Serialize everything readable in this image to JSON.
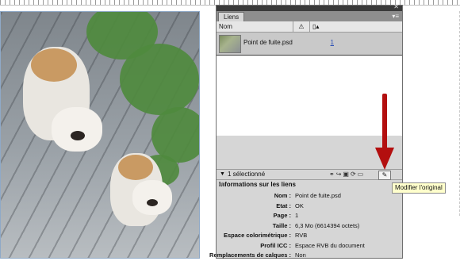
{
  "panel": {
    "tab_label": "Liens",
    "columns": {
      "name": "Nom",
      "warning_icon": "warning-icon",
      "page_icon": "page-icon"
    },
    "rows": [
      {
        "filename": "Point de fuite.psd",
        "page": "1"
      }
    ],
    "status": {
      "selected_text": "1 sélectionné"
    }
  },
  "info": {
    "header": "Informations sur les liens",
    "fields": [
      {
        "key": "Nom :",
        "value": "Point de fuite.psd"
      },
      {
        "key": "Etat :",
        "value": "OK"
      },
      {
        "key": "Page :",
        "value": "1"
      },
      {
        "key": "Taille :",
        "value": "6,3 Mo (6614394 octets)"
      },
      {
        "key": "Espace colorimétrique :",
        "value": "RVB"
      },
      {
        "key": "Profil ICC :",
        "value": "Espace RVB du document"
      },
      {
        "key": "Remplacements de calques :",
        "value": "Non"
      }
    ]
  },
  "tooltip": {
    "text": "Modifier l'original"
  },
  "colors": {
    "arrow": "#b30f0f",
    "tooltip_bg": "#ffffcc",
    "panel_bg": "#d6d6d6"
  }
}
